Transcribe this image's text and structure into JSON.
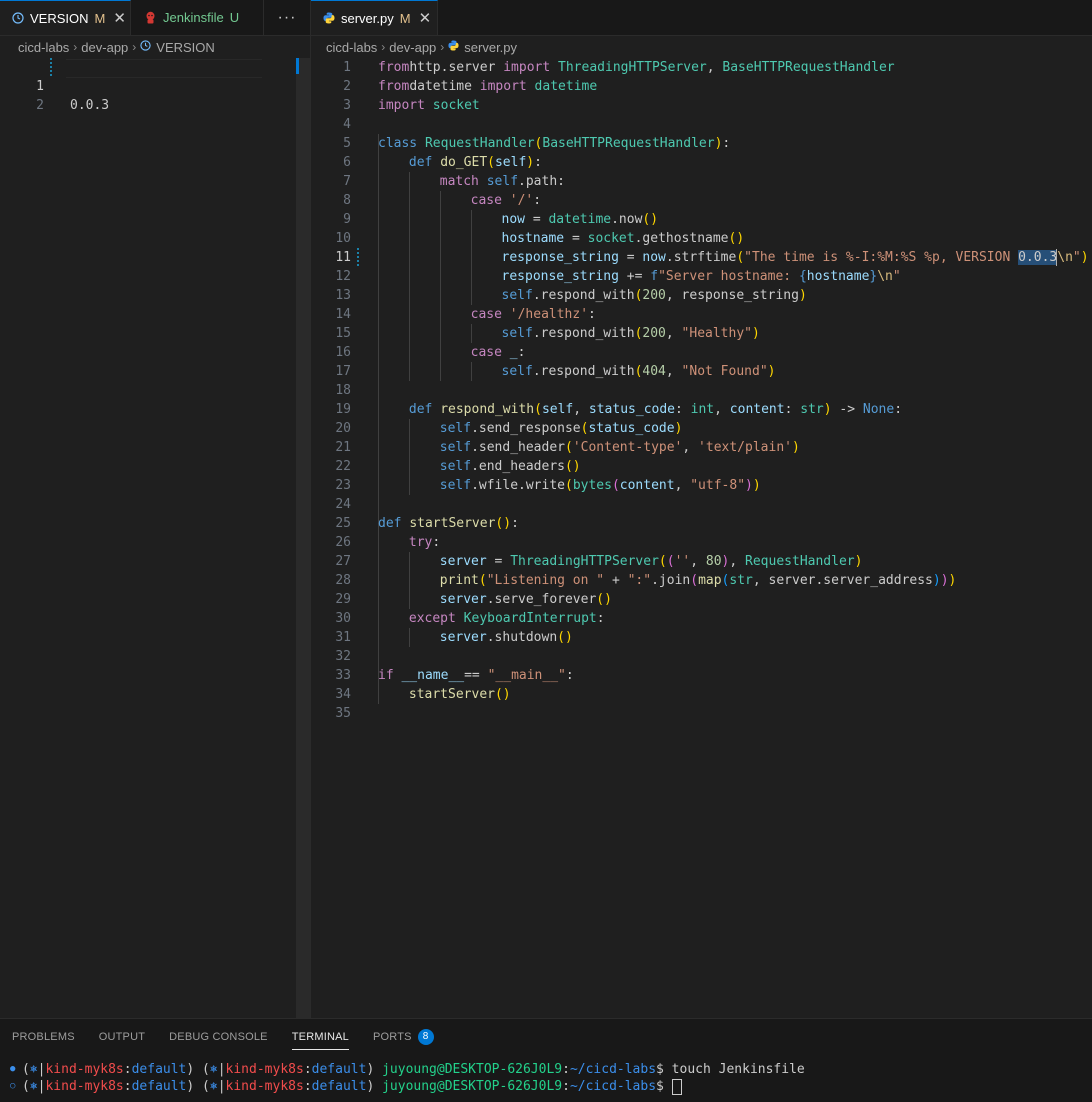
{
  "left_group": {
    "tabs": [
      {
        "icon": "clock-icon",
        "label": "VERSION",
        "flag": "M",
        "close": "✕"
      },
      {
        "icon": "jenkins-icon",
        "label": "Jenkinsfile",
        "flag": "U"
      }
    ],
    "more_actions": "···",
    "breadcrumb": [
      "cicd-labs",
      "dev-app",
      "VERSION"
    ],
    "lines": [
      {
        "n": "1",
        "text": "0.0.3"
      },
      {
        "n": "2",
        "text": ""
      }
    ]
  },
  "right_group": {
    "tab": {
      "icon": "python-icon",
      "label": "server.py",
      "flag": "M",
      "close": "✕"
    },
    "breadcrumb": [
      "cicd-labs",
      "dev-app",
      "server.py"
    ],
    "current_line": "11",
    "lines": [
      {
        "n": "1",
        "i": 0,
        "t": [
          [
            "kw",
            "from"
          ],
          [
            "",
            "http.server "
          ],
          [
            "kw",
            "import"
          ],
          [
            "cls",
            " ThreadingHTTPServer"
          ],
          [
            "",
            ", "
          ],
          [
            "cls",
            "BaseHTTPRequestHandler"
          ]
        ]
      },
      {
        "n": "2",
        "i": 0,
        "t": [
          [
            "kw",
            "from"
          ],
          [
            "",
            "datetime "
          ],
          [
            "kw",
            "import"
          ],
          [
            "cls",
            " datetime"
          ]
        ]
      },
      {
        "n": "3",
        "i": 0,
        "t": [
          [
            "kw",
            "import"
          ],
          [
            "",
            ""
          ],
          [
            "cls",
            " socket"
          ]
        ]
      },
      {
        "n": "4",
        "i": 0,
        "t": []
      },
      {
        "n": "5",
        "i": 0,
        "t": [
          [
            "kd",
            "class "
          ],
          [
            "cls",
            "RequestHandler"
          ],
          [
            "b1",
            "("
          ],
          [
            "cls",
            "BaseHTTPRequestHandler"
          ],
          [
            "b1",
            ")"
          ],
          [
            "",
            ":"
          ]
        ]
      },
      {
        "n": "6",
        "i": 1,
        "t": [
          [
            "kd",
            "def "
          ],
          [
            "fn",
            "do_GET"
          ],
          [
            "b1",
            "("
          ],
          [
            "var",
            "self"
          ],
          [
            "b1",
            ")"
          ],
          [
            "",
            ":"
          ]
        ]
      },
      {
        "n": "7",
        "i": 2,
        "t": [
          [
            "kw",
            "match "
          ],
          [
            "kd",
            "self"
          ],
          [
            "",
            ".path:"
          ]
        ]
      },
      {
        "n": "8",
        "i": 3,
        "t": [
          [
            "kw",
            "case "
          ],
          [
            "str",
            "'/'"
          ],
          [
            "",
            ":"
          ]
        ]
      },
      {
        "n": "9",
        "i": 4,
        "t": [
          [
            "var",
            "now"
          ],
          [
            "",
            " = "
          ],
          [
            "cls",
            "datetime"
          ],
          [
            "",
            ".now"
          ],
          [
            "b1",
            "()"
          ]
        ]
      },
      {
        "n": "10",
        "i": 4,
        "t": [
          [
            "var",
            "hostname"
          ],
          [
            "",
            " = "
          ],
          [
            "cls",
            "socket"
          ],
          [
            "",
            ".gethostname"
          ],
          [
            "b1",
            "()"
          ]
        ]
      },
      {
        "n": "11",
        "i": 4,
        "cur": true,
        "t": [
          [
            "var",
            "response_string"
          ],
          [
            "",
            " = "
          ],
          [
            "var",
            "now"
          ],
          [
            "",
            ".strftime"
          ],
          [
            "b1",
            "("
          ],
          [
            "str",
            "\"The time is %-I:%M:%S %p, VERSION "
          ],
          [
            "sel",
            "0.0.3"
          ],
          [
            "caret",
            ""
          ],
          [
            "esc",
            "\\n"
          ],
          [
            "str",
            "\""
          ],
          [
            "b1",
            ")"
          ]
        ]
      },
      {
        "n": "12",
        "i": 4,
        "t": [
          [
            "var",
            "response_string"
          ],
          [
            "",
            " += "
          ],
          [
            "kd",
            "f"
          ],
          [
            "str",
            "\"Server hostname: "
          ],
          [
            "kd",
            "{"
          ],
          [
            "var",
            "hostname"
          ],
          [
            "kd",
            "}"
          ],
          [
            "esc",
            "\\n"
          ],
          [
            "str",
            "\""
          ]
        ]
      },
      {
        "n": "13",
        "i": 4,
        "t": [
          [
            "kd",
            "self"
          ],
          [
            "",
            ".respond_with"
          ],
          [
            "b1",
            "("
          ],
          [
            "num",
            "200"
          ],
          [
            "",
            ", response_string"
          ],
          [
            "b1",
            ")"
          ]
        ]
      },
      {
        "n": "14",
        "i": 3,
        "t": [
          [
            "kw",
            "case "
          ],
          [
            "str",
            "'/healthz'"
          ],
          [
            "",
            ":"
          ]
        ]
      },
      {
        "n": "15",
        "i": 4,
        "t": [
          [
            "kd",
            "self"
          ],
          [
            "",
            ".respond_with"
          ],
          [
            "b1",
            "("
          ],
          [
            "num",
            "200"
          ],
          [
            "",
            ", "
          ],
          [
            "str",
            "\"Healthy\""
          ],
          [
            "b1",
            ")"
          ]
        ]
      },
      {
        "n": "16",
        "i": 3,
        "t": [
          [
            "kw",
            "case "
          ],
          [
            "var",
            "_"
          ],
          [
            "",
            ":"
          ]
        ]
      },
      {
        "n": "17",
        "i": 4,
        "t": [
          [
            "kd",
            "self"
          ],
          [
            "",
            ".respond_with"
          ],
          [
            "b1",
            "("
          ],
          [
            "num",
            "404"
          ],
          [
            "",
            ", "
          ],
          [
            "str",
            "\"Not Found\""
          ],
          [
            "b1",
            ")"
          ]
        ]
      },
      {
        "n": "18",
        "i": 1,
        "t": []
      },
      {
        "n": "19",
        "i": 1,
        "t": [
          [
            "kd",
            "def "
          ],
          [
            "fn",
            "respond_with"
          ],
          [
            "b1",
            "("
          ],
          [
            "var",
            "self"
          ],
          [
            "",
            ", "
          ],
          [
            "var",
            "status_code"
          ],
          [
            "",
            ": "
          ],
          [
            "cls",
            "int"
          ],
          [
            "",
            ", "
          ],
          [
            "var",
            "content"
          ],
          [
            "",
            ": "
          ],
          [
            "cls",
            "str"
          ],
          [
            "b1",
            ")"
          ],
          [
            "",
            " -> "
          ],
          [
            "kd",
            "None"
          ],
          [
            "",
            ":"
          ]
        ]
      },
      {
        "n": "20",
        "i": 2,
        "t": [
          [
            "kd",
            "self"
          ],
          [
            "",
            ".send_response"
          ],
          [
            "b1",
            "("
          ],
          [
            "var",
            "status_code"
          ],
          [
            "b1",
            ")"
          ]
        ]
      },
      {
        "n": "21",
        "i": 2,
        "t": [
          [
            "kd",
            "self"
          ],
          [
            "",
            ".send_header"
          ],
          [
            "b1",
            "("
          ],
          [
            "str",
            "'Content-type'"
          ],
          [
            "",
            ", "
          ],
          [
            "str",
            "'text/plain'"
          ],
          [
            "b1",
            ")"
          ]
        ]
      },
      {
        "n": "22",
        "i": 2,
        "t": [
          [
            "kd",
            "self"
          ],
          [
            "",
            ".end_headers"
          ],
          [
            "b1",
            "()"
          ]
        ]
      },
      {
        "n": "23",
        "i": 2,
        "t": [
          [
            "kd",
            "self"
          ],
          [
            "",
            ".wfile.write"
          ],
          [
            "b1",
            "("
          ],
          [
            "cls",
            "bytes"
          ],
          [
            "b2",
            "("
          ],
          [
            "var",
            "content"
          ],
          [
            "",
            ", "
          ],
          [
            "str",
            "\"utf-8\""
          ],
          [
            "b2",
            ")"
          ],
          [
            "b1",
            ")"
          ]
        ]
      },
      {
        "n": "24",
        "i": 0,
        "t": []
      },
      {
        "n": "25",
        "i": 0,
        "t": [
          [
            "kd",
            "def "
          ],
          [
            "fn",
            "startServer"
          ],
          [
            "b1",
            "()"
          ],
          [
            "",
            ":"
          ]
        ]
      },
      {
        "n": "26",
        "i": 1,
        "t": [
          [
            "kw",
            "try"
          ],
          [
            "",
            ":"
          ]
        ]
      },
      {
        "n": "27",
        "i": 2,
        "t": [
          [
            "var",
            "server"
          ],
          [
            "",
            " = "
          ],
          [
            "cls",
            "ThreadingHTTPServer"
          ],
          [
            "b1",
            "("
          ],
          [
            "b2",
            "("
          ],
          [
            "str",
            "''"
          ],
          [
            "",
            ", "
          ],
          [
            "num",
            "80"
          ],
          [
            "b2",
            ")"
          ],
          [
            "",
            ", "
          ],
          [
            "cls",
            "RequestHandler"
          ],
          [
            "b1",
            ")"
          ]
        ]
      },
      {
        "n": "28",
        "i": 2,
        "t": [
          [
            "fn",
            "print"
          ],
          [
            "b1",
            "("
          ],
          [
            "str",
            "\"Listening on \""
          ],
          [
            "",
            " + "
          ],
          [
            "str",
            "\":\""
          ],
          [
            "",
            ".join"
          ],
          [
            "b2",
            "("
          ],
          [
            "fn",
            "map"
          ],
          [
            "b3",
            "("
          ],
          [
            "cls",
            "str"
          ],
          [
            "",
            ", server.server_address"
          ],
          [
            "b3",
            ")"
          ],
          [
            "b2",
            ")"
          ],
          [
            "b1",
            ")"
          ]
        ]
      },
      {
        "n": "29",
        "i": 2,
        "t": [
          [
            "var",
            "server"
          ],
          [
            "",
            ".serve_forever"
          ],
          [
            "b1",
            "()"
          ]
        ]
      },
      {
        "n": "30",
        "i": 1,
        "t": [
          [
            "kw",
            "except "
          ],
          [
            "cls",
            "KeyboardInterrupt"
          ],
          [
            "",
            ":"
          ]
        ]
      },
      {
        "n": "31",
        "i": 2,
        "t": [
          [
            "var",
            "server"
          ],
          [
            "",
            ".shutdown"
          ],
          [
            "b1",
            "()"
          ]
        ]
      },
      {
        "n": "32",
        "i": 0,
        "t": []
      },
      {
        "n": "33",
        "i": 0,
        "t": [
          [
            "kw",
            "if "
          ],
          [
            "var",
            "__name__"
          ],
          [
            "",
            "== "
          ],
          [
            "str",
            "\"__main__\""
          ],
          [
            "",
            ":"
          ]
        ]
      },
      {
        "n": "34",
        "i": 1,
        "t": [
          [
            "fn",
            "startServer"
          ],
          [
            "b1",
            "()"
          ]
        ]
      },
      {
        "n": "35",
        "i": 0,
        "t": []
      }
    ]
  },
  "panel": {
    "tabs": [
      {
        "label": "PROBLEMS"
      },
      {
        "label": "OUTPUT"
      },
      {
        "label": "DEBUG CONSOLE"
      },
      {
        "label": "TERMINAL",
        "active": true
      },
      {
        "label": "PORTS",
        "badge": "8"
      }
    ],
    "terminal": [
      {
        "dot": "●",
        "ctx1": "kind-myk8s",
        "ns1": "default",
        "ctx2": "kind-myk8s",
        "ns2": "default",
        "user": "juyoung@DESKTOP-626J0L9",
        "path": "~/cicd-labs",
        "cmd": "touch Jenkinsfile"
      },
      {
        "dot": "○",
        "ctx1": "kind-myk8s",
        "ns1": "default",
        "ctx2": "kind-myk8s",
        "ns2": "default",
        "user": "juyoung@DESKTOP-626J0L9",
        "path": "~/cicd-labs",
        "cmd": "",
        "cursor": true
      }
    ]
  },
  "colors": {
    "accent": "#0078d4",
    "modified": "#e2c08d",
    "untracked": "#73c991",
    "selection": "#264f78"
  }
}
